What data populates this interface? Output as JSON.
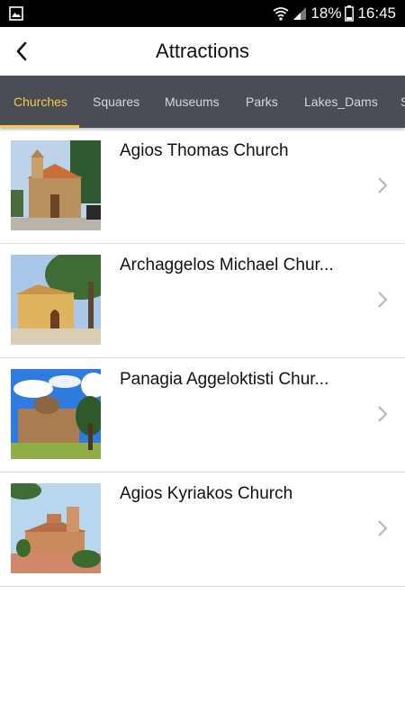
{
  "status": {
    "battery": "18%",
    "time": "16:45"
  },
  "header": {
    "title": "Attractions"
  },
  "tabs": [
    {
      "label": "Churches"
    },
    {
      "label": "Squares"
    },
    {
      "label": "Museums"
    },
    {
      "label": "Parks"
    },
    {
      "label": "Lakes_Dams"
    },
    {
      "label": "S"
    }
  ],
  "items": [
    {
      "title": "Agios Thomas Church"
    },
    {
      "title": "Archaggelos Michael Chur..."
    },
    {
      "title": "Panagia Aggeloktisti Chur..."
    },
    {
      "title": "Agios Kyriakos Church"
    }
  ],
  "colors": {
    "tab_bg": "#4a4d53",
    "tab_active": "#f3c84b",
    "tab_text": "#d7d8da"
  }
}
